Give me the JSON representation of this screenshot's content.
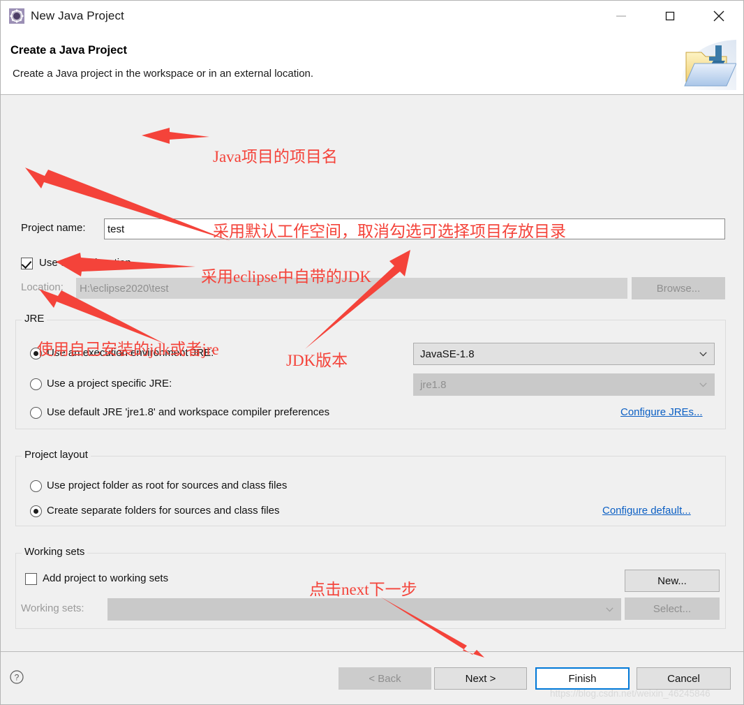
{
  "window": {
    "title": "New Java Project",
    "icon": "java-project-icon",
    "controls": {
      "minimize": "minimize-icon",
      "maximize": "maximize-icon",
      "close": "close-icon"
    }
  },
  "header": {
    "title": "Create a Java Project",
    "description": "Create a Java project in the workspace or in an external location.",
    "banner_icon": "new-java-project-folder-icon"
  },
  "form": {
    "project_name_label": "Project name:",
    "project_name_value": "test",
    "project_name_placeholder": "",
    "use_default_location_label": "Use default location",
    "use_default_location_checked": true,
    "location_label": "Location:",
    "location_value": "H:\\eclipse2020\\test",
    "browse_label": "Browse..."
  },
  "jre": {
    "group_title": "JRE",
    "option_execution_env": "Use an execution environment JRE:",
    "option_project_specific": "Use a project specific JRE:",
    "option_default_jre": "Use default JRE 'jre1.8' and workspace compiler preferences",
    "selected": "execution_env",
    "execution_env_value": "JavaSE-1.8",
    "project_specific_value": "jre1.8",
    "configure_link": "Configure JREs..."
  },
  "project_layout": {
    "group_title": "Project layout",
    "option_project_folder": "Use project folder as root for sources and class files",
    "option_separate_folders": "Create separate folders for sources and class files",
    "selected": "separate_folders",
    "configure_link": "Configure default..."
  },
  "working_sets": {
    "group_title": "Working sets",
    "add_to_working_sets_label": "Add project to working sets",
    "add_to_working_sets_checked": false,
    "working_sets_label": "Working sets:",
    "working_sets_value": "",
    "new_button": "New...",
    "select_button": "Select..."
  },
  "footer": {
    "help_icon": "help-question-icon",
    "back_button": "< Back",
    "next_button": "Next >",
    "finish_button": "Finish",
    "cancel_button": "Cancel",
    "back_disabled": true,
    "finish_is_default": true
  },
  "annotations": [
    {
      "id": "anno-project-name",
      "text": "Java项目的项目名"
    },
    {
      "id": "anno-default-location",
      "text": "采用默认工作空间，取消勾选可选择项目存放目录"
    },
    {
      "id": "anno-builtin-jdk",
      "text": "采用eclipse中自带的JDK"
    },
    {
      "id": "anno-own-jdk",
      "text": "使用自己安装的jdk或者jre"
    },
    {
      "id": "anno-jdk-version",
      "text": "JDK版本"
    },
    {
      "id": "anno-click-next",
      "text": "点击next下一步"
    }
  ],
  "watermark": {
    "text": "https://blog.csdn.net/weixin_46245846"
  },
  "colors": {
    "annotation_red": "#f4433a",
    "accent_blue": "#0078d7",
    "link_blue": "#0b5fc4",
    "dialog_bg": "#f0f0f0"
  }
}
